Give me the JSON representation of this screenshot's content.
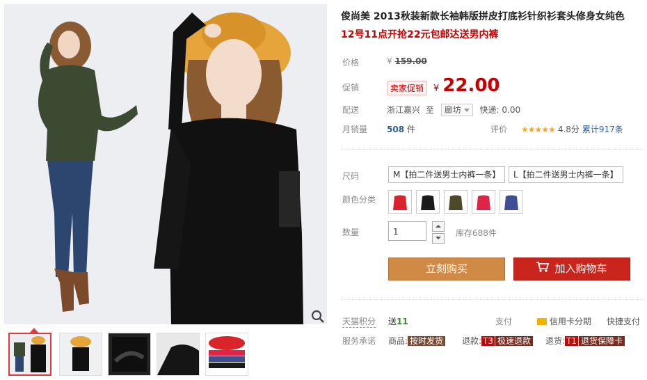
{
  "product": {
    "title": "俊尚美 2013秋装新款长袖韩版拼皮打底衫针织衫套头修身女纯色",
    "subtitle": "12号11点开抢22元包邮达送男内裤"
  },
  "price": {
    "label": "价格",
    "original_prefix": "¥",
    "original": "159.00",
    "promo_label": "促销",
    "promo_badge": "卖家促销",
    "current_prefix": "¥",
    "current": "22.00"
  },
  "shipping": {
    "label": "配送",
    "from": "浙江嘉兴",
    "to_word": "至",
    "destination": "廊坊",
    "express": "快递: 0.00"
  },
  "sales": {
    "label": "月销量",
    "count": "508",
    "unit": "件",
    "rating_label": "评价",
    "stars": "★★★★★",
    "score": "4.8分",
    "reviews": "累计917条"
  },
  "options": {
    "size_label": "尺码",
    "sizes": [
      "M【拍二件送男士内裤一条】",
      "L【拍二件送男士内裤一条】"
    ],
    "color_label": "颜色分类",
    "colors": [
      "#d8242a",
      "#1a1a1a",
      "#4c4a2a",
      "#e02448",
      "#3e4f94"
    ]
  },
  "quantity": {
    "label": "数量",
    "value": "1",
    "stock": "库存688件"
  },
  "actions": {
    "buy_now": "立刻购买",
    "add_to_cart": "加入购物车"
  },
  "extras": {
    "points_label": "天猫积分",
    "points_prefix": "送",
    "points_value": "11",
    "pay_label": "支付",
    "card_pay": "信用卡分期",
    "quick_pay": "快捷支付",
    "service_label": "服务承诺",
    "svc1_prefix": "商品:",
    "svc1_tag": "按时发货",
    "svc2_prefix": "退款:",
    "svc2_tagA": "T3",
    "svc2_tagB": "极速退款",
    "svc3_prefix": "退货:",
    "svc3_tagA": "T1",
    "svc3_tagB": "退货保障卡"
  },
  "colors": {
    "accent_red": "#c40000",
    "buy_button": "#d08a45",
    "cart_button": "#c9251c"
  }
}
